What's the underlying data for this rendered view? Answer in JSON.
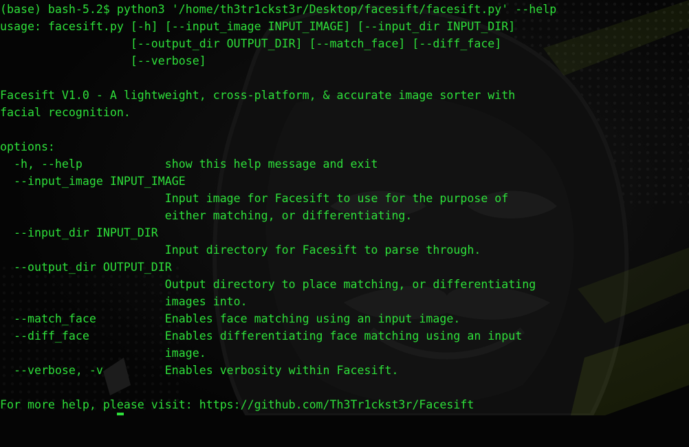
{
  "terminal": {
    "text_color": "#2ee03a",
    "background_color": "#050505",
    "prompt": "(base) bash-5.2$",
    "command": "python3 '/home/th3tr1ckst3r/Desktop/facesift/facesift.py' --help",
    "lines": [
      "(base) bash-5.2$ python3 '/home/th3tr1ckst3r/Desktop/facesift/facesift.py' --help",
      "usage: facesift.py [-h] [--input_image INPUT_IMAGE] [--input_dir INPUT_DIR]",
      "                   [--output_dir OUTPUT_DIR] [--match_face] [--diff_face]",
      "                   [--verbose]",
      "",
      "Facesift V1.0 - A lightweight, cross-platform, & accurate image sorter with",
      "facial recognition.",
      "",
      "options:",
      "  -h, --help            show this help message and exit",
      "  --input_image INPUT_IMAGE",
      "                        Input image for Facesift to use for the purpose of",
      "                        either matching, or differentiating.",
      "  --input_dir INPUT_DIR",
      "                        Input directory for Facesift to parse through.",
      "  --output_dir OUTPUT_DIR",
      "                        Output directory to place matching, or differentiating",
      "                        images into.",
      "  --match_face          Enables face matching using an input image.",
      "  --diff_face           Enables differentiating face matching using an input",
      "                        image.",
      "  --verbose, -v         Enables verbosity within Facesift.",
      "",
      "For more help, please visit: https://github.com/Th3Tr1ckst3r/Facesift"
    ]
  },
  "wallpaper": {
    "icon": "hooded-hacker-mask-icon",
    "accent_color": "#b8e62a"
  }
}
